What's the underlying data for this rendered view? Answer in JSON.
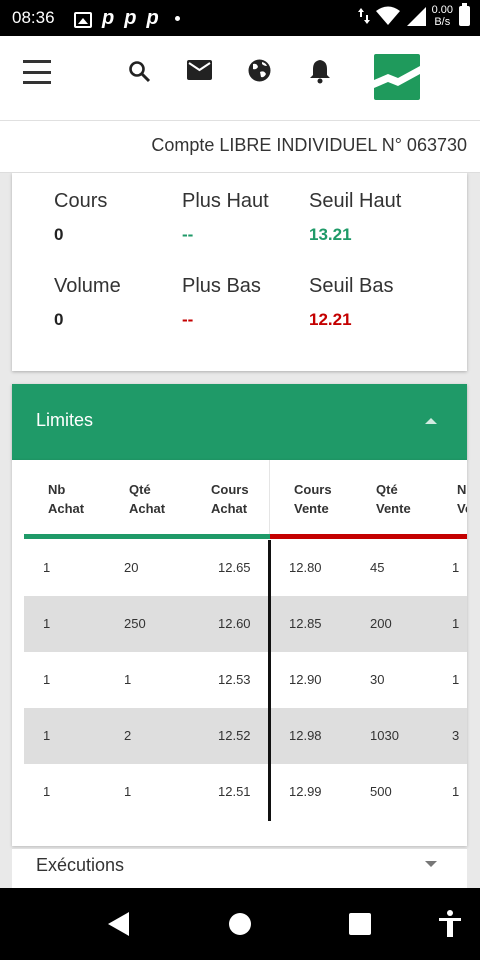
{
  "status_bar": {
    "time": "08:36",
    "speed_value": "0.00",
    "speed_unit": "B/s",
    "notification_letters": [
      "p",
      "p",
      "p"
    ]
  },
  "toolbar": {
    "icons": [
      "menu-icon",
      "search-icon",
      "mail-icon",
      "globe-icon",
      "bell-icon",
      "logo"
    ]
  },
  "account": {
    "label": "Compte LIBRE INDIVIDUEL N° 063730"
  },
  "quote": {
    "cours": {
      "label": "Cours",
      "value": "0"
    },
    "plus_haut": {
      "label": "Plus Haut",
      "value": "--"
    },
    "seuil_haut": {
      "label": "Seuil Haut",
      "value": "13.21"
    },
    "volume": {
      "label": "Volume",
      "value": "0"
    },
    "plus_bas": {
      "label": "Plus Bas",
      "value": "--"
    },
    "seuil_bas": {
      "label": "Seuil Bas",
      "value": "12.21"
    },
    "colors": {
      "green": "#1f9a68",
      "red": "#c40000"
    }
  },
  "limites": {
    "title": "Limites",
    "headers": [
      [
        "Nb",
        "Achat"
      ],
      [
        "Qté",
        "Achat"
      ],
      [
        "Cours",
        "Achat"
      ],
      [
        "Cours",
        "Vente"
      ],
      [
        "Qté",
        "Vente"
      ],
      [
        "Nb",
        "Vente"
      ]
    ],
    "rows": [
      [
        "1",
        "20",
        "12.65",
        "12.80",
        "45",
        "1"
      ],
      [
        "1",
        "250",
        "12.60",
        "12.85",
        "200",
        "1"
      ],
      [
        "1",
        "1",
        "12.53",
        "12.90",
        "30",
        "1"
      ],
      [
        "1",
        "2",
        "12.52",
        "12.98",
        "1030",
        "3"
      ],
      [
        "1",
        "1",
        "12.51",
        "12.99",
        "500",
        "1"
      ]
    ]
  },
  "executions": {
    "title": "Exécutions"
  }
}
